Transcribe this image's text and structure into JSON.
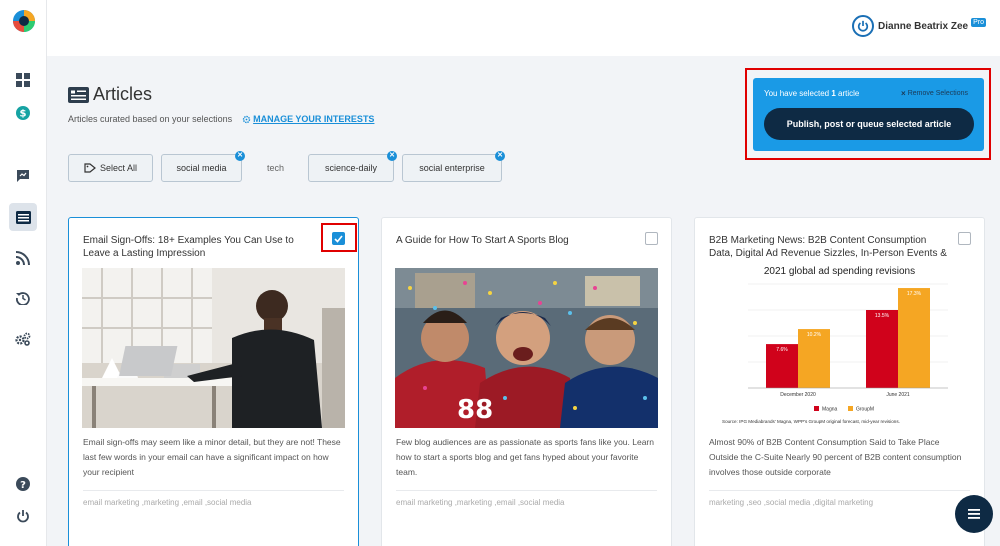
{
  "header": {
    "user_name": "Dianne Beatrix Zee",
    "badge": "Pro"
  },
  "page": {
    "title": "Articles",
    "subtitle": "Articles curated based on your selections",
    "manage_link": "MANAGE YOUR INTERESTS"
  },
  "chips": [
    {
      "label": "Select All"
    },
    {
      "label": "social media"
    },
    {
      "label": "tech"
    },
    {
      "label": "science-daily"
    },
    {
      "label": "social enterprise"
    }
  ],
  "selection": {
    "prefix": "You have selected",
    "count": "1",
    "suffix": "article",
    "remove_label": "Remove Selections",
    "publish_label": "Publish, post or queue selected article"
  },
  "cards": [
    {
      "title": "Email Sign-Offs: 18+ Examples You Can Use to Leave a Lasting Impression",
      "checked": true,
      "description": "Email sign-offs may seem like a minor detail, but they are not! These last few words in your email can have a significant impact on how your recipient",
      "tags": "email marketing ,marketing ,email ,social media"
    },
    {
      "title": "A Guide for How To Start A Sports Blog",
      "checked": false,
      "description": "Few blog audiences are as passionate as sports fans like you. Learn how to start a sports blog and get fans hyped about your favorite team.",
      "tags": "email marketing ,marketing ,email ,social media"
    },
    {
      "title": "B2B Marketing News: B2B Content Consumption Data, Digital Ad Revenue Sizzles, In-Person Events &",
      "checked": false,
      "description": "Almost 90% of B2B Content Consumption Said to Take Place Outside the C-Suite Nearly 90 percent of B2B content consumption involves those outside corporate",
      "tags": "marketing ,seo ,social media ,digital marketing"
    }
  ],
  "chart_data": {
    "type": "bar",
    "title": "2021 global ad spending revisions",
    "categories": [
      "December 2020",
      "June 2021"
    ],
    "series": [
      {
        "name": "Magna",
        "values": [
          7.6,
          13.5
        ],
        "labels": [
          "7.6%",
          "13.5%"
        ],
        "color": "#d0021b"
      },
      {
        "name": "GroupM",
        "values": [
          10.2,
          17.3
        ],
        "labels": [
          "10.2%",
          "17.3%"
        ],
        "color": "#f5a623"
      }
    ],
    "ylim": [
      0,
      18
    ],
    "grid": true,
    "legend": "bottom",
    "source": "Source: IPG Mediabrands' Magna, WPP's GroupM original forecast, mid-year revisions."
  },
  "colors": {
    "accent": "#1a8fd8",
    "dark": "#0e2a44",
    "highlight": "#e00000"
  }
}
